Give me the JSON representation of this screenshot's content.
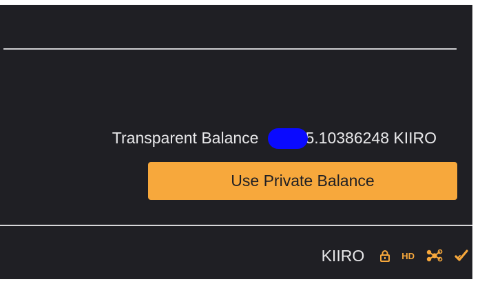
{
  "balance": {
    "label": "Transparent Balance",
    "amount_suffix": "5.10386248 KIIRO"
  },
  "actions": {
    "use_private_label": "Use Private Balance"
  },
  "status_bar": {
    "ticker": "KIIRO",
    "hd_label": "HD",
    "icons": [
      "lock-icon",
      "hd-icon",
      "network-icon",
      "check-icon"
    ]
  },
  "colors": {
    "background": "#1f1f24",
    "accent": "#f7a83c",
    "text": "#e8e8ea",
    "redaction": "#0a0aff"
  }
}
